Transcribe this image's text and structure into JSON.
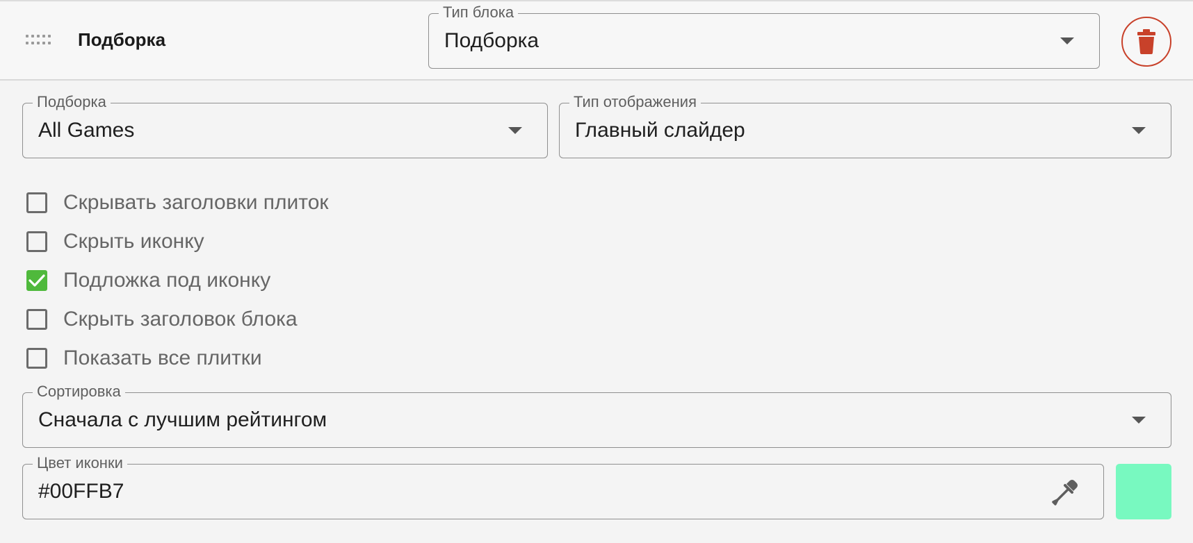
{
  "header": {
    "title": "Подборка",
    "block_type": {
      "label": "Тип блока",
      "value": "Подборка"
    }
  },
  "form": {
    "collection": {
      "label": "Подборка",
      "value": "All Games"
    },
    "display_type": {
      "label": "Тип отображения",
      "value": "Главный слайдер"
    },
    "checkboxes": [
      {
        "label": "Скрывать заголовки плиток",
        "checked": false
      },
      {
        "label": "Скрыть иконку",
        "checked": false
      },
      {
        "label": "Подложка под иконку",
        "checked": true
      },
      {
        "label": "Скрыть заголовок блока",
        "checked": false
      },
      {
        "label": "Показать все плитки",
        "checked": false
      }
    ],
    "sort": {
      "label": "Сортировка",
      "value": "Сначала с лучшим рейтингом"
    },
    "icon_color": {
      "label": "Цвет иконки",
      "value": "#00FFB7"
    }
  },
  "colors": {
    "delete_accent": "#c8412a",
    "checkbox_checked": "#4fb93c",
    "swatch_preview": "#78f9c0"
  },
  "icons": {
    "drag": "drag-handle-icon",
    "delete": "trash-icon",
    "dropdown": "caret-down-icon",
    "color_picker": "eyedropper-icon",
    "check": "check-icon"
  }
}
